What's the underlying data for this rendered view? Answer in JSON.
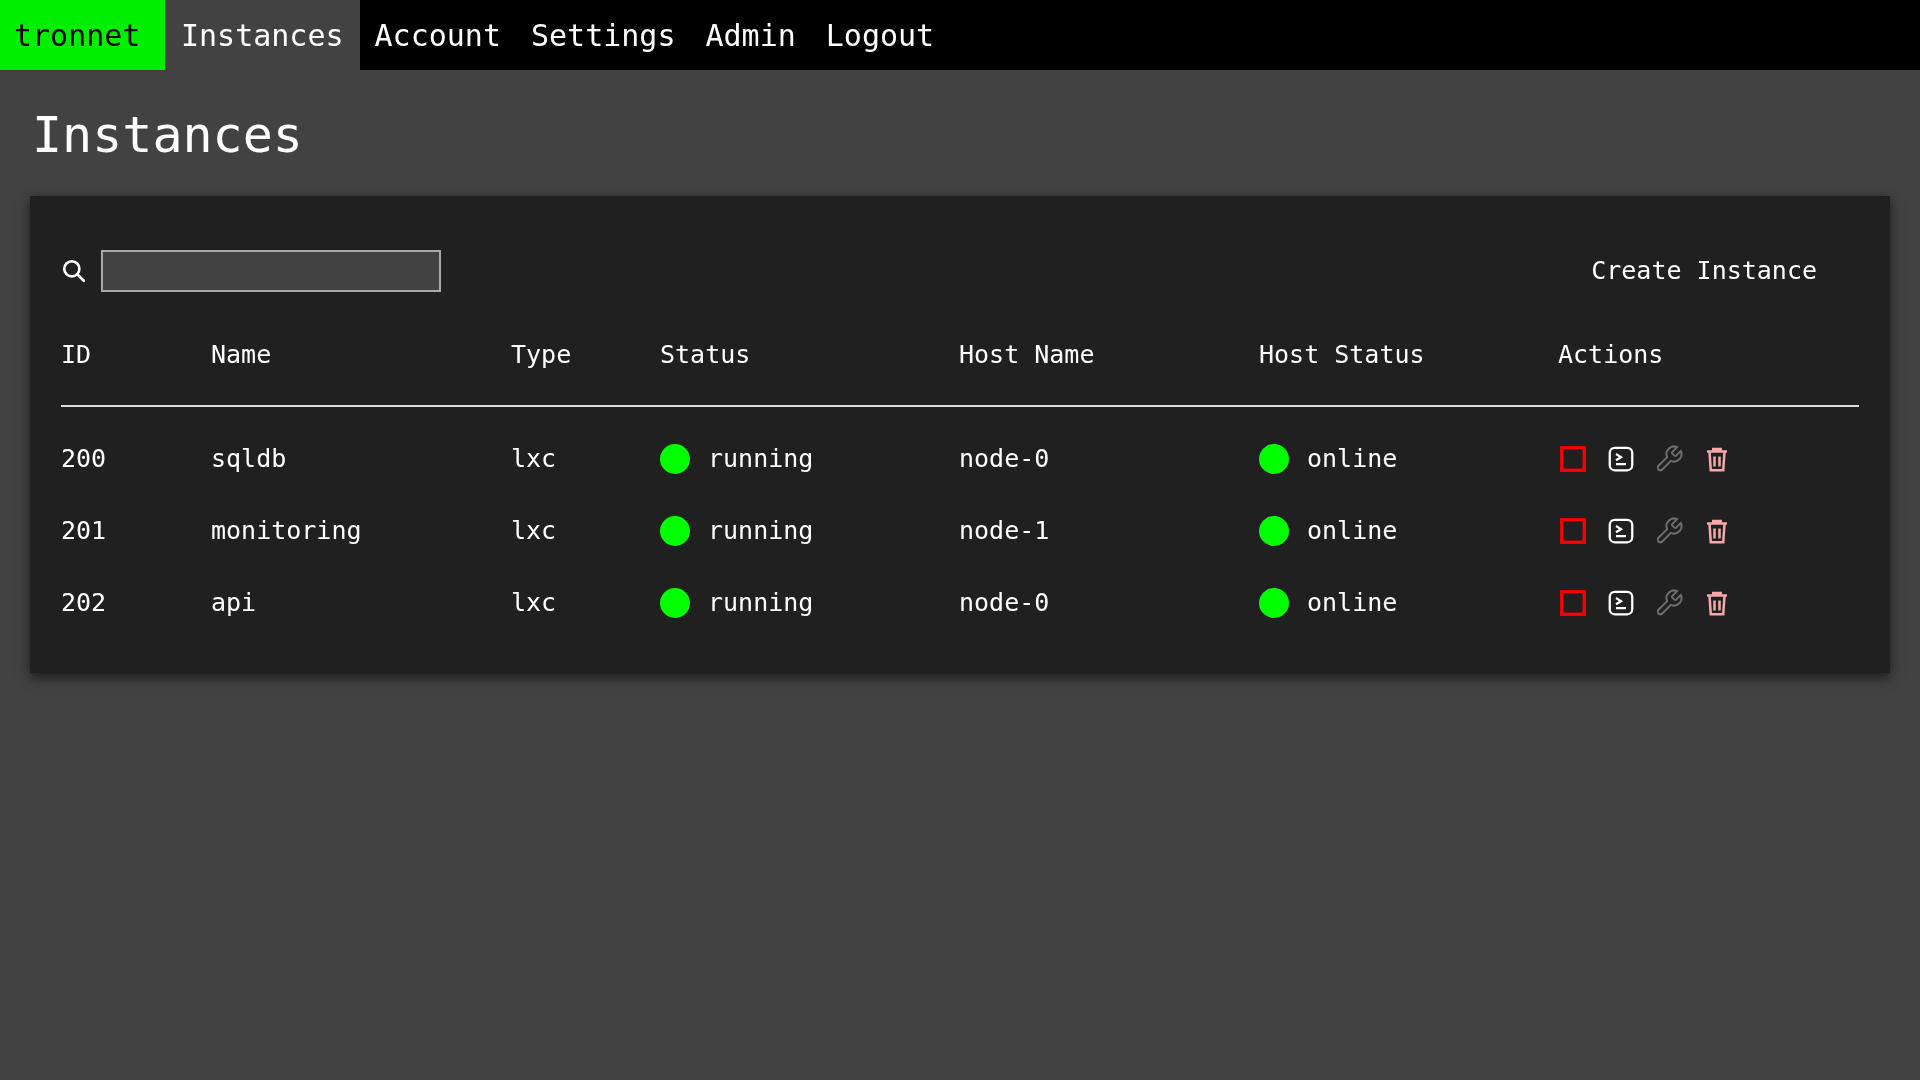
{
  "nav": {
    "brand": "tronnet",
    "items": [
      {
        "label": "Instances",
        "selected": true
      },
      {
        "label": "Account",
        "selected": false
      },
      {
        "label": "Settings",
        "selected": false
      },
      {
        "label": "Admin",
        "selected": false
      },
      {
        "label": "Logout",
        "selected": false
      }
    ]
  },
  "page_title": "Instances",
  "create_button": "Create Instance",
  "table": {
    "columns": [
      "ID",
      "Name",
      "Type",
      "Status",
      "Host Name",
      "Host Status",
      "Actions"
    ],
    "rows": [
      {
        "id": "200",
        "name": "sqldb",
        "type": "lxc",
        "status": {
          "label": "running",
          "color": "#00ff00"
        },
        "host_name": "node-0",
        "host_status": {
          "label": "online",
          "color": "#00ff00"
        },
        "actions": [
          {
            "kind": "stop",
            "disabled": false
          },
          {
            "kind": "console",
            "disabled": false
          },
          {
            "kind": "config",
            "disabled": true
          },
          {
            "kind": "delete",
            "disabled": false
          }
        ]
      },
      {
        "id": "201",
        "name": "monitoring",
        "type": "lxc",
        "status": {
          "label": "running",
          "color": "#00ff00"
        },
        "host_name": "node-1",
        "host_status": {
          "label": "online",
          "color": "#00ff00"
        },
        "actions": [
          {
            "kind": "stop",
            "disabled": false
          },
          {
            "kind": "console",
            "disabled": false
          },
          {
            "kind": "config",
            "disabled": true
          },
          {
            "kind": "delete",
            "disabled": false
          }
        ]
      },
      {
        "id": "202",
        "name": "api",
        "type": "lxc",
        "status": {
          "label": "running",
          "color": "#00ff00"
        },
        "host_name": "node-0",
        "host_status": {
          "label": "online",
          "color": "#00ff00"
        },
        "actions": [
          {
            "kind": "stop",
            "disabled": false
          },
          {
            "kind": "console",
            "disabled": false
          },
          {
            "kind": "config",
            "disabled": true
          },
          {
            "kind": "delete",
            "disabled": false
          }
        ]
      }
    ]
  }
}
